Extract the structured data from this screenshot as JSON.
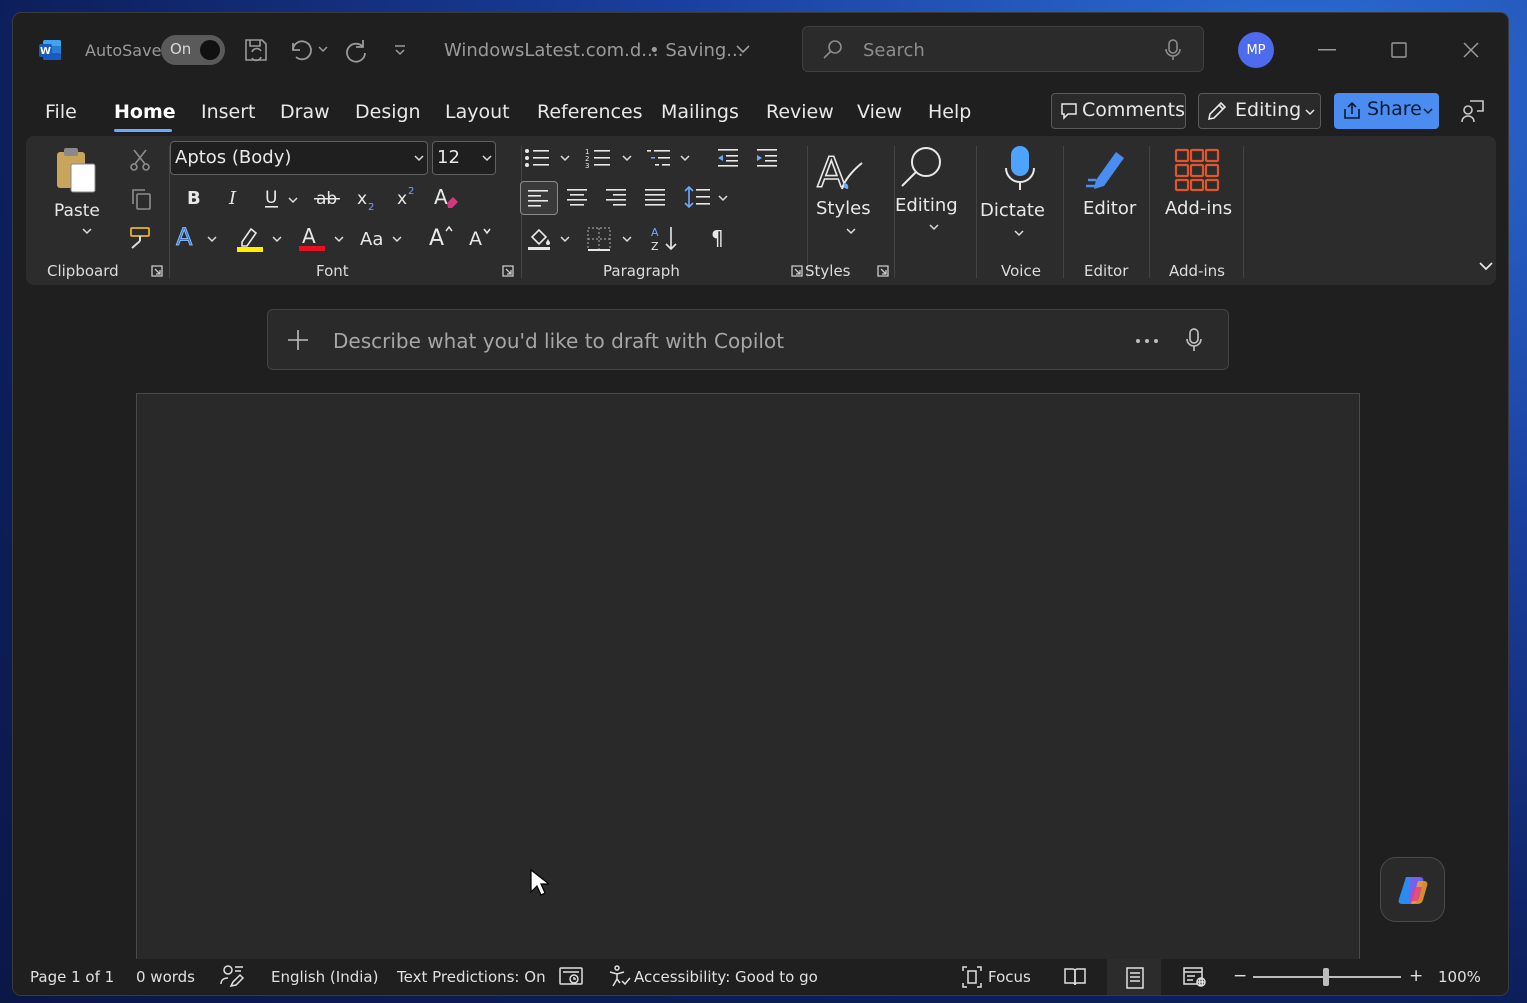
{
  "titlebar": {
    "autosave_label": "AutoSave",
    "autosave_state": "On",
    "filename": "WindowsLatest.com.d...",
    "save_status": "• Saving...",
    "search_placeholder": "Search",
    "avatar_initials": "MP"
  },
  "menu": {
    "tabs": [
      "File",
      "Home",
      "Insert",
      "Draw",
      "Design",
      "Layout",
      "References",
      "Mailings",
      "Review",
      "View",
      "Help"
    ],
    "active": "Home",
    "comments_label": "Comments",
    "editing_label": "Editing",
    "share_label": "Share"
  },
  "ribbon": {
    "paste_label": "Paste",
    "font_name": "Aptos (Body)",
    "font_size": "12",
    "styles_label": "Styles",
    "editing_label": "Editing",
    "dictate_label": "Dictate",
    "editor_label": "Editor",
    "addins_label": "Add-ins",
    "groups": {
      "clipboard": "Clipboard",
      "font": "Font",
      "paragraph": "Paragraph",
      "styles": "Styles",
      "voice": "Voice",
      "editor": "Editor",
      "addins": "Add-ins"
    },
    "colors": {
      "highlight": "#ffee00",
      "font_color": "#e81123",
      "dictate": "#4da3ff",
      "editor": "#4a8cf0",
      "addins": "#e0562a"
    }
  },
  "copilot": {
    "placeholder": "Describe what you'd like to draft with Copilot"
  },
  "status": {
    "page": "Page 1 of 1",
    "words": "0 words",
    "language": "English (India)",
    "predictions": "Text Predictions: On",
    "accessibility": "Accessibility: Good to go",
    "focus": "Focus",
    "zoom": "100%",
    "zoom_minus": "−",
    "zoom_plus": "+"
  }
}
